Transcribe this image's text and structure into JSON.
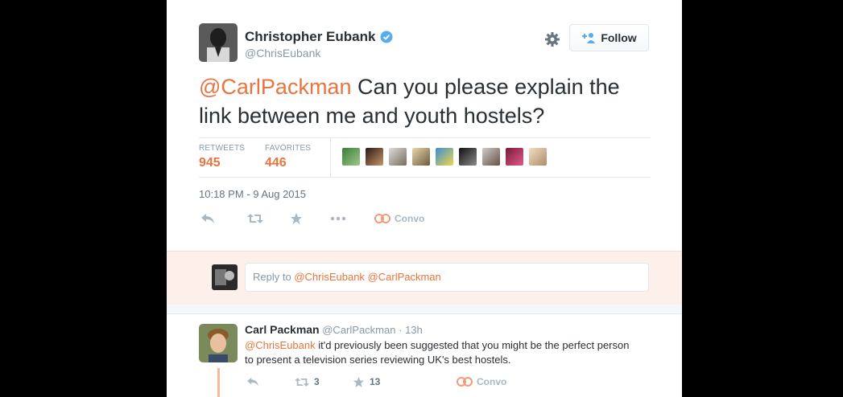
{
  "tweet": {
    "author_name": "Christopher Eubank",
    "author_handle": "@ChrisEubank",
    "follow_label": "Follow",
    "mention": "@CarlPackman",
    "text": " Can you please explain the link between me and youth hostels?",
    "retweets_label": "RETWEETS",
    "retweets_count": "945",
    "favorites_label": "FAVORITES",
    "favorites_count": "446",
    "timestamp": "10:18 PM - 9 Aug 2015",
    "convo_label": "Convo"
  },
  "reply_box": {
    "prefix": "Reply to ",
    "mentions": "@ChrisEubank @CarlPackman"
  },
  "reply_tweet": {
    "author_name": "Carl Packman",
    "author_handle": "@CarlPackman",
    "age": "13h",
    "mention": "@ChrisEubank",
    "text": " it'd previously been suggested that you might be the perfect person to present a television series reviewing UK's best hostels.",
    "retweet_count": "3",
    "favorite_count": "13",
    "convo_label": "Convo"
  },
  "colors": {
    "accent": "#e9743d",
    "muted": "#8899a6",
    "verified": "#55acee"
  },
  "icons": [
    "verified-icon",
    "gear-icon",
    "follow-person-icon",
    "reply-icon",
    "retweet-icon",
    "favorite-icon",
    "more-icon",
    "convo-icon"
  ]
}
